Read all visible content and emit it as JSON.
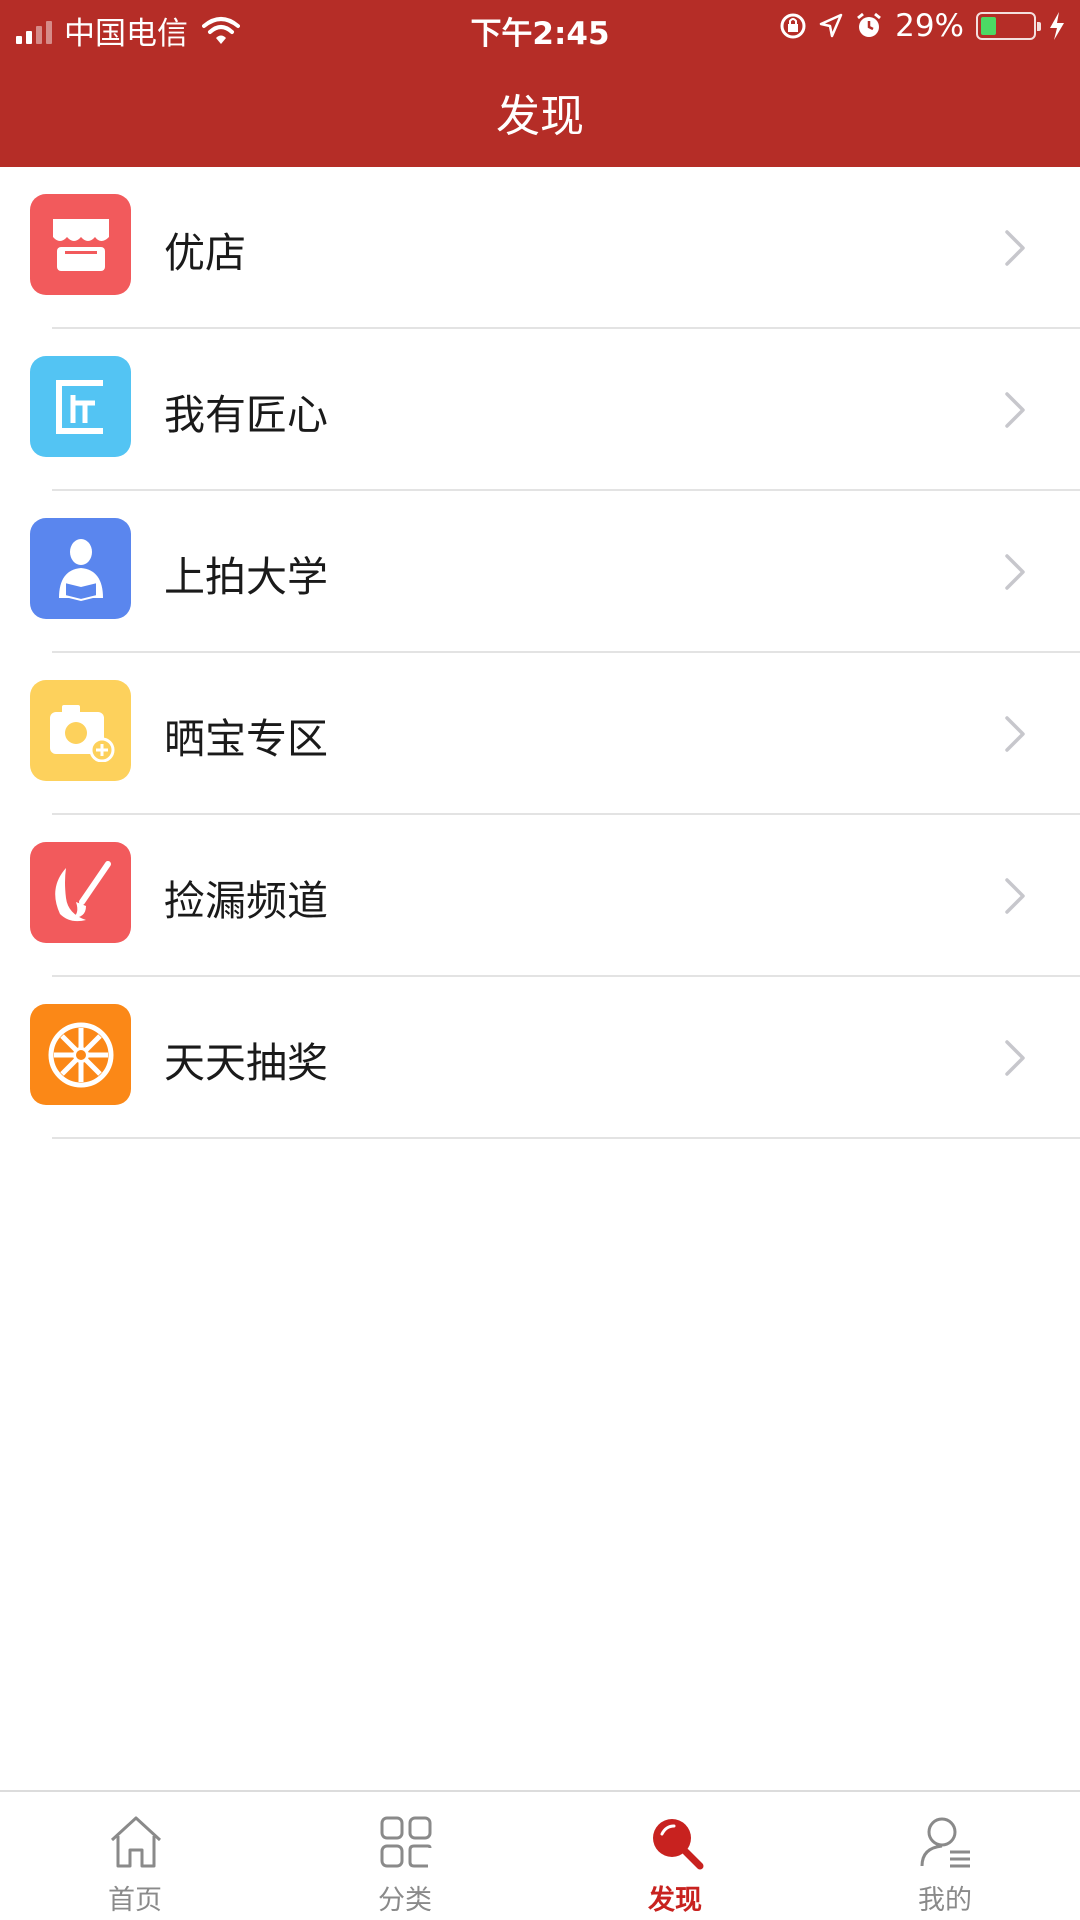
{
  "status_bar": {
    "carrier": "中国电信",
    "time": "下午2:45",
    "battery": "29%",
    "battery_level": 0.29
  },
  "header": {
    "title": "发现",
    "background": "#b52d27"
  },
  "list": [
    {
      "label": "优店",
      "icon": "shop-icon",
      "color": "#f25a5c"
    },
    {
      "label": "我有匠心",
      "icon": "craftsman-icon",
      "color": "#53c4f3"
    },
    {
      "label": "上拍大学",
      "icon": "reader-icon",
      "color": "#5a86ee"
    },
    {
      "label": "晒宝专区",
      "icon": "camera-icon",
      "color": "#fdd15c"
    },
    {
      "label": "捡漏频道",
      "icon": "brush-icon",
      "color": "#f25a5c"
    },
    {
      "label": "天天抽奖",
      "icon": "lottery-wheel-icon",
      "color": "#fb8817"
    }
  ],
  "tabbar": {
    "active_color": "#c8221f",
    "tabs": [
      {
        "label": "首页",
        "icon": "home-icon"
      },
      {
        "label": "分类",
        "icon": "grid-icon"
      },
      {
        "label": "发现",
        "icon": "discover-search-icon",
        "active": true
      },
      {
        "label": "我的",
        "icon": "profile-icon"
      }
    ]
  }
}
